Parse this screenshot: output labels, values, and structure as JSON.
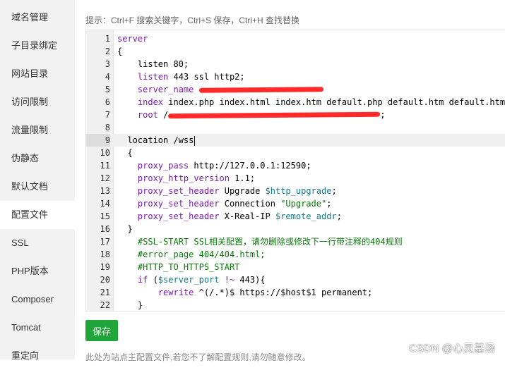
{
  "sidebar": {
    "items": [
      {
        "label": "域名管理"
      },
      {
        "label": "子目录绑定"
      },
      {
        "label": "网站目录"
      },
      {
        "label": "访问限制"
      },
      {
        "label": "流量限制"
      },
      {
        "label": "伪静态"
      },
      {
        "label": "默认文档"
      },
      {
        "label": "配置文件",
        "active": true
      },
      {
        "label": "SSL"
      },
      {
        "label": "PHP版本"
      },
      {
        "label": "Composer"
      },
      {
        "label": "Tomcat"
      },
      {
        "label": "重定向"
      }
    ]
  },
  "hint": "提示：Ctrl+F 搜索关键字，Ctrl+S 保存，Ctrl+H 查找替换",
  "editor": {
    "active_line": 9,
    "lines": [
      {
        "n": "1",
        "tokens": [
          {
            "t": "server",
            "c": "kw"
          }
        ]
      },
      {
        "n": "2",
        "tokens": [
          {
            "t": "{",
            "c": "nm"
          }
        ]
      },
      {
        "n": "3",
        "tokens": [
          {
            "t": "    listen 80;",
            "c": "nm"
          }
        ]
      },
      {
        "n": "4",
        "tokens": [
          {
            "t": "    ",
            "c": "nm"
          },
          {
            "t": "listen",
            "c": "kw"
          },
          {
            "t": " 443 ssl http2;",
            "c": "nm"
          }
        ]
      },
      {
        "n": "5",
        "tokens": [
          {
            "t": "    ",
            "c": "nm"
          },
          {
            "t": "server_name",
            "c": "kw"
          },
          {
            "t": " ",
            "c": "nm"
          }
        ],
        "redact": 176
      },
      {
        "n": "6",
        "tokens": [
          {
            "t": "    ",
            "c": "nm"
          },
          {
            "t": "index",
            "c": "kw"
          },
          {
            "t": " index.php index.html index.htm default.php default.htm default.html;",
            "c": "nm"
          }
        ]
      },
      {
        "n": "7",
        "tokens": [
          {
            "t": "    ",
            "c": "nm"
          },
          {
            "t": "root",
            "c": "kw"
          },
          {
            "t": " /",
            "c": "nm"
          }
        ],
        "redact": 300,
        "after": ";"
      },
      {
        "n": "8",
        "tokens": [
          {
            "t": "",
            "c": "nm"
          }
        ]
      },
      {
        "n": "9",
        "tokens": [
          {
            "t": "  location /wss",
            "c": "nm"
          }
        ],
        "caret": true
      },
      {
        "n": "10",
        "tokens": [
          {
            "t": "  {",
            "c": "nm"
          }
        ]
      },
      {
        "n": "11",
        "tokens": [
          {
            "t": "    ",
            "c": "nm"
          },
          {
            "t": "proxy_pass",
            "c": "kw"
          },
          {
            "t": " http://127.0.0.1:12590;",
            "c": "nm"
          }
        ]
      },
      {
        "n": "12",
        "tokens": [
          {
            "t": "    ",
            "c": "nm"
          },
          {
            "t": "proxy_http_version",
            "c": "kw"
          },
          {
            "t": " 1.1;",
            "c": "nm"
          }
        ]
      },
      {
        "n": "13",
        "tokens": [
          {
            "t": "    ",
            "c": "nm"
          },
          {
            "t": "proxy_set_header",
            "c": "kw"
          },
          {
            "t": " Upgrade ",
            "c": "nm"
          },
          {
            "t": "$http_upgrade",
            "c": "vr"
          },
          {
            "t": ";",
            "c": "nm"
          }
        ]
      },
      {
        "n": "14",
        "tokens": [
          {
            "t": "    ",
            "c": "nm"
          },
          {
            "t": "proxy_set_header",
            "c": "kw"
          },
          {
            "t": " Connection ",
            "c": "nm"
          },
          {
            "t": "\"Upgrade\"",
            "c": "st"
          },
          {
            "t": ";",
            "c": "nm"
          }
        ]
      },
      {
        "n": "15",
        "tokens": [
          {
            "t": "    ",
            "c": "nm"
          },
          {
            "t": "proxy_set_header",
            "c": "kw"
          },
          {
            "t": " X-Real-IP ",
            "c": "nm"
          },
          {
            "t": "$remote_addr",
            "c": "vr"
          },
          {
            "t": ";",
            "c": "nm"
          }
        ]
      },
      {
        "n": "16",
        "tokens": [
          {
            "t": "  }",
            "c": "nm"
          }
        ]
      },
      {
        "n": "17",
        "tokens": [
          {
            "t": "    ",
            "c": "nm"
          },
          {
            "t": "#SSL-START SSL相关配置，请勿删除或修改下一行带注释的404规则",
            "c": "cm"
          }
        ]
      },
      {
        "n": "18",
        "tokens": [
          {
            "t": "    ",
            "c": "nm"
          },
          {
            "t": "#error_page 404/404.html;",
            "c": "cm"
          }
        ]
      },
      {
        "n": "19",
        "tokens": [
          {
            "t": "    ",
            "c": "nm"
          },
          {
            "t": "#HTTP_TO_HTTPS_START",
            "c": "cm"
          }
        ]
      },
      {
        "n": "20",
        "tokens": [
          {
            "t": "    ",
            "c": "nm"
          },
          {
            "t": "if",
            "c": "kw"
          },
          {
            "t": " (",
            "c": "nm"
          },
          {
            "t": "$server_port",
            "c": "vr"
          },
          {
            "t": " ",
            "c": "nm"
          },
          {
            "t": "!~",
            "c": "kw"
          },
          {
            "t": " 443){",
            "c": "nm"
          }
        ]
      },
      {
        "n": "21",
        "tokens": [
          {
            "t": "        ",
            "c": "nm"
          },
          {
            "t": "rewrite",
            "c": "kw"
          },
          {
            "t": " ^(/.*)$ https://$host$1 permanent;",
            "c": "nm"
          }
        ]
      },
      {
        "n": "22",
        "tokens": [
          {
            "t": "    }",
            "c": "nm"
          }
        ]
      }
    ]
  },
  "save_label": "保存",
  "footnote": "此处为站点主配置文件,若您不了解配置规则,请勿随意修改。",
  "watermark": "CSDN @心灵基汤"
}
